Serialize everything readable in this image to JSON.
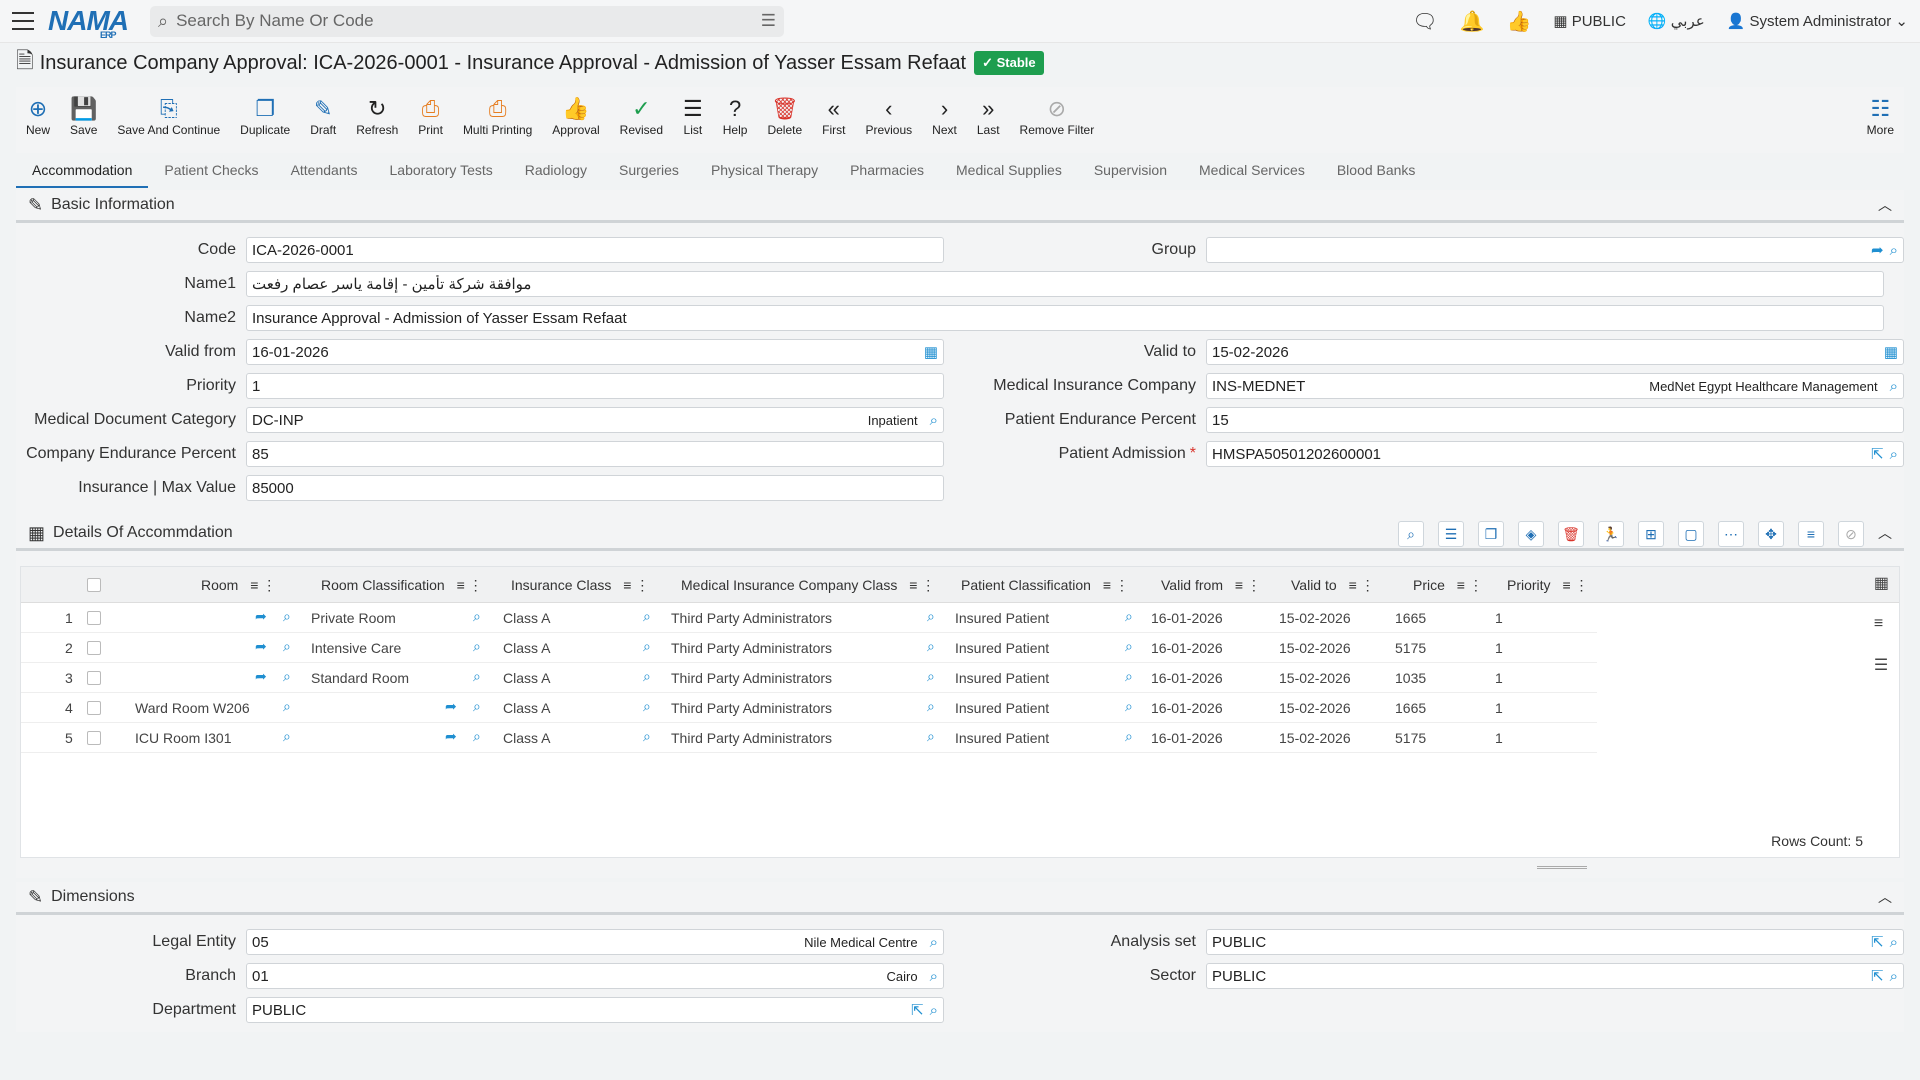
{
  "topbar": {
    "logo": "NAMA",
    "logo_sub": "ERP",
    "search_placeholder": "Search By Name Or Code",
    "public": "PUBLIC",
    "language": "عربي",
    "user": "System Administrator"
  },
  "title": {
    "text": "Insurance Company Approval: ICA-2026-0001 - Insurance Approval - Admission of Yasser Essam Refaat",
    "status": "Stable"
  },
  "toolbar": [
    {
      "label": "New",
      "icon": "plus-icon",
      "color": "#1f6fb5"
    },
    {
      "label": "Save",
      "icon": "save-icon",
      "color": "#1f6fb5"
    },
    {
      "label": "Save And Continue",
      "icon": "save-continue-icon",
      "color": "#1f6fb5"
    },
    {
      "label": "Duplicate",
      "icon": "duplicate-icon",
      "color": "#1f6fb5"
    },
    {
      "label": "Draft",
      "icon": "draft-icon",
      "color": "#1f6fb5"
    },
    {
      "label": "Refresh",
      "icon": "refresh-icon",
      "color": "#222"
    },
    {
      "label": "Print",
      "icon": "print-icon",
      "color": "#e67e22"
    },
    {
      "label": "Multi Printing",
      "icon": "multi-print-icon",
      "color": "#e67e22"
    },
    {
      "label": "Approval",
      "icon": "thumbs-up-icon",
      "color": "#aaa"
    },
    {
      "label": "Revised",
      "icon": "revised-icon",
      "color": "#1e9e4f"
    },
    {
      "label": "List",
      "icon": "list-icon",
      "color": "#222"
    },
    {
      "label": "Help",
      "icon": "help-icon",
      "color": "#222"
    },
    {
      "label": "Delete",
      "icon": "delete-icon",
      "color": "#d9342b"
    },
    {
      "label": "First",
      "icon": "first-icon",
      "color": "#222"
    },
    {
      "label": "Previous",
      "icon": "previous-icon",
      "color": "#222"
    },
    {
      "label": "Next",
      "icon": "next-icon",
      "color": "#222"
    },
    {
      "label": "Last",
      "icon": "last-icon",
      "color": "#222"
    },
    {
      "label": "Remove Filter",
      "icon": "remove-filter-icon",
      "color": "#aaa"
    }
  ],
  "more_label": "More",
  "tabs": [
    "Accommodation",
    "Patient Checks",
    "Attendants",
    "Laboratory Tests",
    "Radiology",
    "Surgeries",
    "Physical Therapy",
    "Pharmacies",
    "Medical Supplies",
    "Supervision",
    "Medical Services",
    "Blood Banks"
  ],
  "basic": {
    "title": "Basic Information",
    "code_label": "Code",
    "code": "ICA-2026-0001",
    "group_label": "Group",
    "group": "",
    "name1_label": "Name1",
    "name1": "موافقة شركة تأمين - إقامة ياسر عصام رفعت",
    "name2_label": "Name2",
    "name2": "Insurance Approval - Admission of Yasser Essam Refaat",
    "valid_from_label": "Valid from",
    "valid_from": "16-01-2026",
    "valid_to_label": "Valid to",
    "valid_to": "15-02-2026",
    "priority_label": "Priority",
    "priority": "1",
    "mic_label": "Medical Insurance Company",
    "mic": "INS-MEDNET",
    "mic_tag": "MedNet Egypt Healthcare Management",
    "mdc_label": "Medical Document Category",
    "mdc": "DC-INP",
    "mdc_tag": "Inpatient",
    "pep_label": "Patient Endurance Percent",
    "pep": "15",
    "cep_label": "Company Endurance Percent",
    "cep": "85",
    "pa_label": "Patient Admission",
    "pa": "HMSPA50501202600001",
    "max_label": "Insurance | Max Value",
    "max": "85000"
  },
  "details": {
    "title": "Details Of Accommdation",
    "columns": [
      "Room",
      "Room Classification",
      "Insurance Class",
      "Medical Insurance Company Class",
      "Patient Classification",
      "Valid from",
      "Valid to",
      "Price",
      "Priority"
    ],
    "rows": [
      {
        "n": "1",
        "room": "",
        "rc": "Private Room",
        "ic": "Class A",
        "micc": "Third Party Administrators",
        "pc": "Insured Patient",
        "vf": "16-01-2026",
        "vt": "15-02-2026",
        "price": "1665",
        "pr": "1"
      },
      {
        "n": "2",
        "room": "",
        "rc": "Intensive Care",
        "ic": "Class A",
        "micc": "Third Party Administrators",
        "pc": "Insured Patient",
        "vf": "16-01-2026",
        "vt": "15-02-2026",
        "price": "5175",
        "pr": "1"
      },
      {
        "n": "3",
        "room": "",
        "rc": "Standard Room",
        "ic": "Class A",
        "micc": "Third Party Administrators",
        "pc": "Insured Patient",
        "vf": "16-01-2026",
        "vt": "15-02-2026",
        "price": "1035",
        "pr": "1"
      },
      {
        "n": "4",
        "room": "Ward Room W206",
        "rc": "",
        "ic": "Class A",
        "micc": "Third Party Administrators",
        "pc": "Insured Patient",
        "vf": "16-01-2026",
        "vt": "15-02-2026",
        "price": "1665",
        "pr": "1"
      },
      {
        "n": "5",
        "room": "ICU Room I301",
        "rc": "",
        "ic": "Class A",
        "micc": "Third Party Administrators",
        "pc": "Insured Patient",
        "vf": "16-01-2026",
        "vt": "15-02-2026",
        "price": "5175",
        "pr": "1"
      }
    ],
    "rows_count": "Rows Count: 5"
  },
  "dimensions": {
    "title": "Dimensions",
    "le_label": "Legal Entity",
    "le": "05",
    "le_tag": "Nile Medical Centre",
    "as_label": "Analysis set",
    "as": "PUBLIC",
    "br_label": "Branch",
    "br": "01",
    "br_tag": "Cairo",
    "sec_label": "Sector",
    "sec": "PUBLIC",
    "dep_label": "Department",
    "dep": "PUBLIC"
  }
}
